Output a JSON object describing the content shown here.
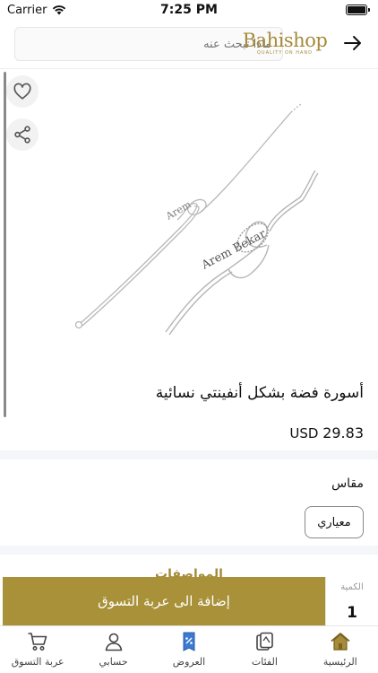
{
  "status_bar": {
    "carrier": "Carrier",
    "time": "7:25 PM"
  },
  "header": {
    "search_placeholder": "ماذا تبحث عنه",
    "logo_text": "Bahishop",
    "logo_tagline": "QUALITY ON HAND",
    "brand_color": "#a58a3a"
  },
  "product": {
    "title": "أسورة فضة بشكل أنفينتي نسائية",
    "currency": "USD",
    "price": "29.83"
  },
  "size": {
    "label": "مقاس",
    "option": "معياري"
  },
  "specs": {
    "title": "المواصفات"
  },
  "cart": {
    "add_label": "إضافة الى عربة التسوق",
    "qty_label": "الكمية",
    "qty_value": "1",
    "color": "#a89138"
  },
  "tabs": [
    {
      "label": "الرئيسية",
      "icon": "home-icon"
    },
    {
      "label": "الفئات",
      "icon": "categories-icon"
    },
    {
      "label": "العروض",
      "icon": "offers-icon"
    },
    {
      "label": "حسابي",
      "icon": "account-icon"
    },
    {
      "label": "عربة التسوق",
      "icon": "cart-icon"
    }
  ]
}
